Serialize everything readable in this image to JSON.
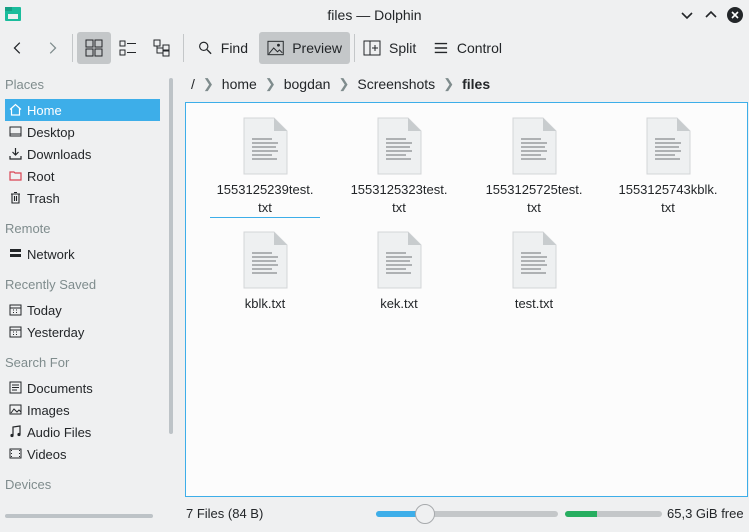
{
  "window": {
    "title": "files — Dolphin"
  },
  "toolbar": {
    "back_icon": "chevron-left-icon",
    "forward_icon": "chevron-right-icon",
    "find_label": "Find",
    "preview_label": "Preview",
    "split_label": "Split",
    "control_label": "Control",
    "view_mode_selected": "icons"
  },
  "sidebar": {
    "sections": {
      "places": "Places",
      "remote": "Remote",
      "recent": "Recently Saved",
      "search": "Search For",
      "devices": "Devices"
    },
    "places": [
      {
        "label": "Home",
        "icon": "home-icon",
        "active": true
      },
      {
        "label": "Desktop",
        "icon": "desktop-icon"
      },
      {
        "label": "Downloads",
        "icon": "download-icon"
      },
      {
        "label": "Root",
        "icon": "root-folder-icon",
        "color": "#da4453"
      },
      {
        "label": "Trash",
        "icon": "trash-icon"
      }
    ],
    "remote": [
      {
        "label": "Network",
        "icon": "network-icon"
      }
    ],
    "recent": [
      {
        "label": "Today",
        "icon": "calendar-icon"
      },
      {
        "label": "Yesterday",
        "icon": "calendar-icon"
      }
    ],
    "search": [
      {
        "label": "Documents",
        "icon": "document-icon"
      },
      {
        "label": "Images",
        "icon": "image-icon"
      },
      {
        "label": "Audio Files",
        "icon": "music-icon"
      },
      {
        "label": "Videos",
        "icon": "video-icon"
      }
    ]
  },
  "breadcrumb": {
    "root": "/",
    "parts": [
      "home",
      "bogdan",
      "Screenshots",
      "files"
    ]
  },
  "files": [
    {
      "name": "1553125239test.txt",
      "line1": "1553125239test.",
      "line2": "txt"
    },
    {
      "name": "1553125323test.txt",
      "line1": "1553125323test.",
      "line2": "txt"
    },
    {
      "name": "1553125725test.txt",
      "line1": "1553125725test.",
      "line2": "txt"
    },
    {
      "name": "1553125743kblk.txt",
      "line1": "1553125743kblk.",
      "line2": "txt"
    },
    {
      "name": "kblk.txt",
      "line1": "kblk.txt",
      "line2": ""
    },
    {
      "name": "kek.txt",
      "line1": "kek.txt",
      "line2": ""
    },
    {
      "name": "test.txt",
      "line1": "test.txt",
      "line2": ""
    }
  ],
  "status": {
    "summary": "7 Files (84 B)",
    "free_space": "65,3 GiB free",
    "zoom_fraction": 0.27,
    "disk_used_fraction": 0.33
  },
  "colors": {
    "accent": "#3daee9",
    "disk": "#27ae60"
  }
}
